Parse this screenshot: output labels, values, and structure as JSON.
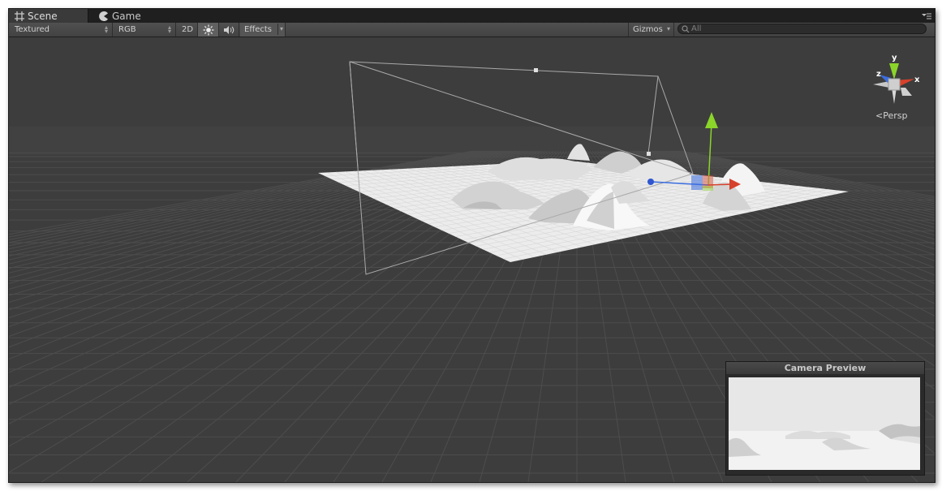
{
  "tabs": [
    {
      "label": "Scene",
      "icon": "grid-icon",
      "active": true
    },
    {
      "label": "Game",
      "icon": "pacman-icon",
      "active": false
    }
  ],
  "toolbar": {
    "draw_mode": "Textured",
    "render_mode": "RGB",
    "mode_2d": "2D",
    "lighting_icon": "sun-icon",
    "audio_icon": "speaker-icon",
    "effects_label": "Effects",
    "gizmos_label": "Gizmos",
    "search_placeholder": "All"
  },
  "orientation_gizmo": {
    "axes": [
      "y",
      "z",
      "x"
    ],
    "projection_label": "Persp"
  },
  "camera_preview": {
    "title": "Camera Preview"
  },
  "colors": {
    "viewport_bg": "#3d3d3d",
    "grid": "#4b4b4b",
    "axis_x": "#d6412b",
    "axis_y": "#8bd42a",
    "axis_z": "#3a6de0"
  }
}
